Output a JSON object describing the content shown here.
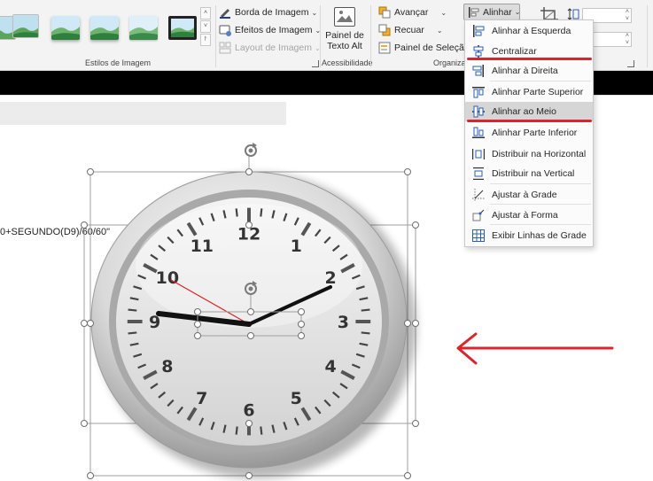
{
  "ribbon": {
    "image_styles": {
      "label": "Estilos de Imagem",
      "scroll_up": "˄",
      "scroll_down": "˅",
      "scroll_more": "⨡"
    },
    "picture_border": "Borda de Imagem",
    "picture_effects": "Efeitos de Imagem",
    "picture_layout": "Layout de Imagem",
    "accessibility": {
      "alt_text_line1": "Painel de",
      "alt_text_line2": "Texto Alt",
      "label": "Acessibilidade"
    },
    "arrange": {
      "bring_forward": "Avançar",
      "send_backward": "Recuar",
      "selection_pane": "Painel de Seleção",
      "label": "Organizar",
      "align": "Alinhar"
    }
  },
  "sheet": {
    "formula_fragment": "0+SEGUNDO(D9)/60/60\""
  },
  "align_menu": {
    "items": [
      {
        "label": "Alinhar à Esquerda",
        "icon": "align-left-icon"
      },
      {
        "label": "Centralizar",
        "icon": "align-center-icon"
      },
      {
        "label": "Alinhar à Direita",
        "icon": "align-right-icon"
      },
      {
        "label": "Alinhar Parte Superior",
        "icon": "align-top-icon"
      },
      {
        "label": "Alinhar ao Meio",
        "icon": "align-middle-icon"
      },
      {
        "label": "Alinhar Parte Inferior",
        "icon": "align-bottom-icon"
      },
      {
        "label": "Distribuir na Horizontal",
        "icon": "distribute-horizontal-icon"
      },
      {
        "label": "Distribuir na Vertical",
        "icon": "distribute-vertical-icon"
      },
      {
        "label": "Ajustar à Grade",
        "icon": "snap-to-grid-icon"
      },
      {
        "label": "Ajustar à Forma",
        "icon": "snap-to-shape-icon"
      },
      {
        "label": "Exibir Linhas de Grade",
        "icon": "view-gridlines-icon"
      }
    ],
    "highlighted": "Alinhar ao Meio"
  },
  "clock": {
    "numbers": [
      "12",
      "1",
      "2",
      "3",
      "4",
      "5",
      "6",
      "7",
      "8",
      "9",
      "10",
      "11"
    ]
  },
  "colors": {
    "annotation_red": "#d9262c",
    "menu_highlight": "#d6d6d6",
    "second_hand": "#e02020"
  }
}
